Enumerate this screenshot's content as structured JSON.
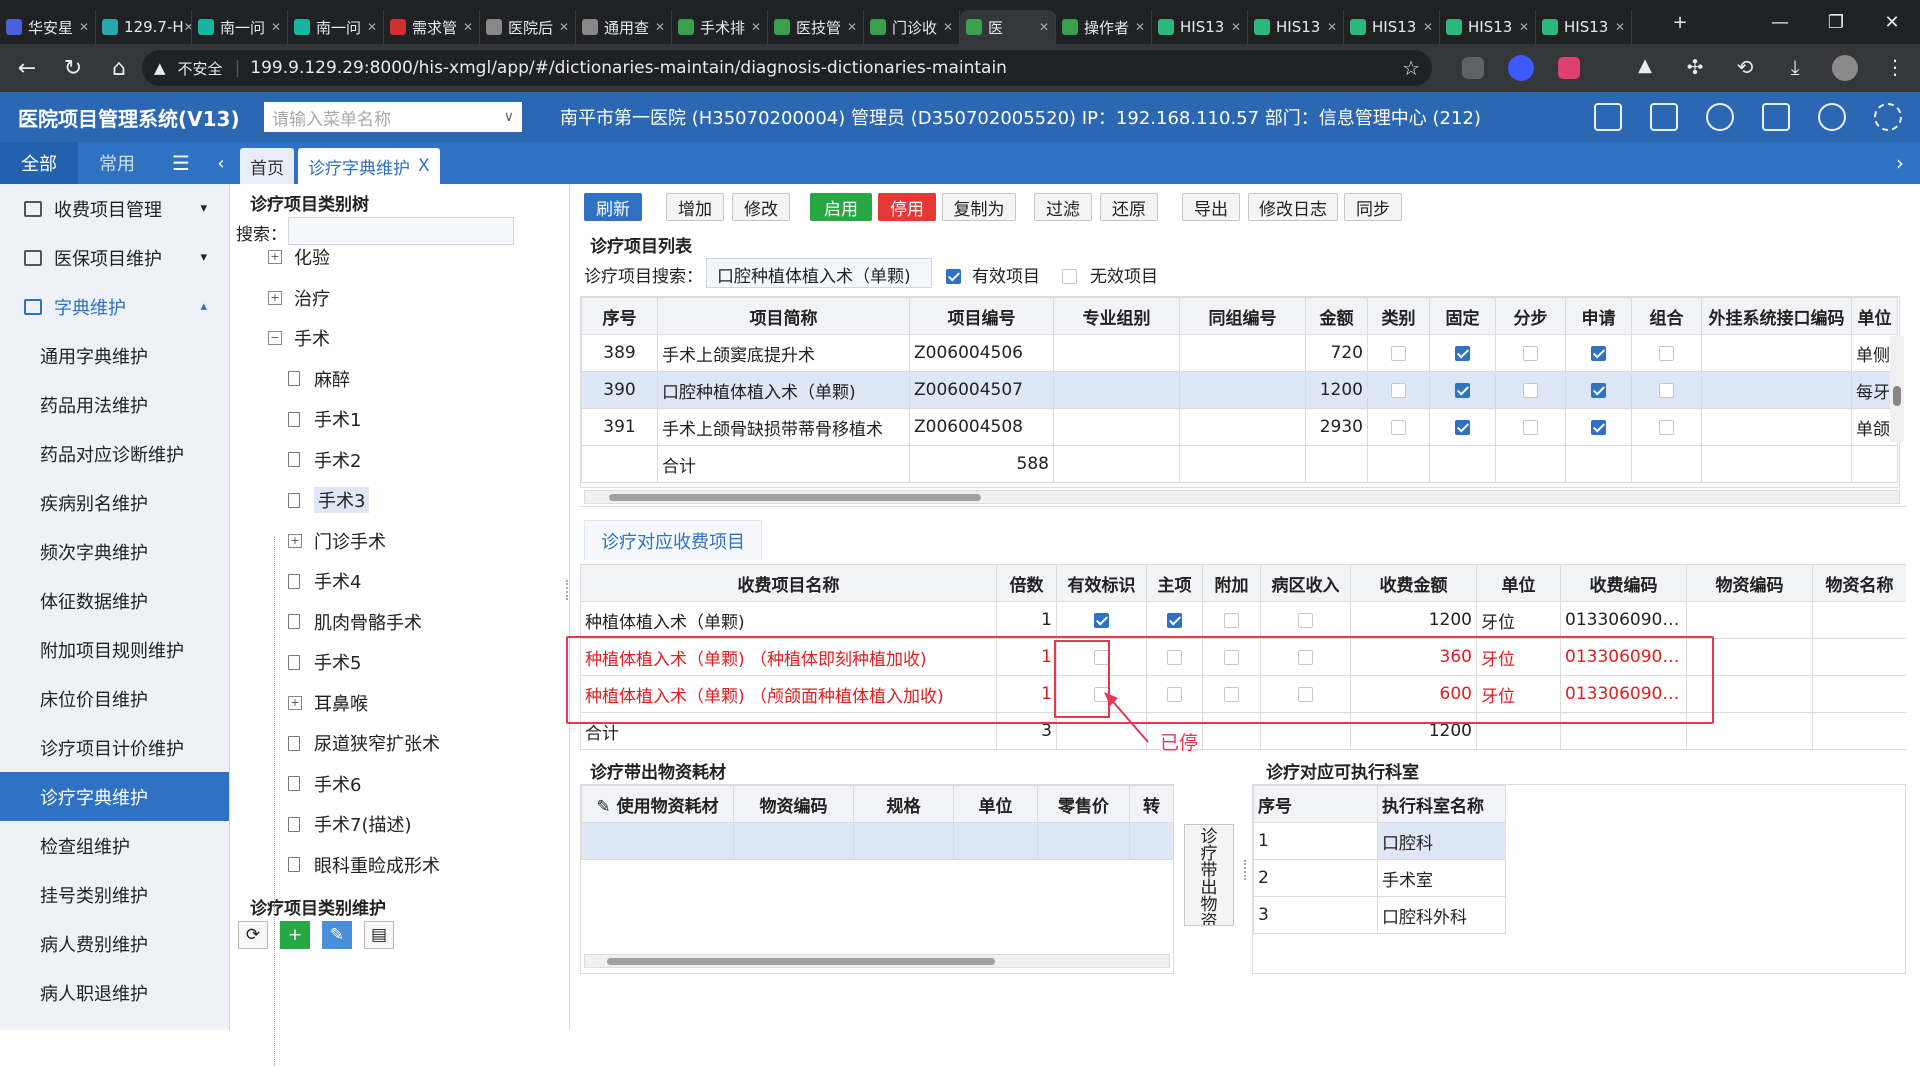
{
  "browser": {
    "tabs": [
      {
        "label": "华安星",
        "color": "#4a5fd8"
      },
      {
        "label": "129.7-H",
        "color": "#2aa8a8"
      },
      {
        "label": "南一问",
        "color": "#17b5a0"
      },
      {
        "label": "南一问",
        "color": "#17b5a0"
      },
      {
        "label": "需求管",
        "color": "#d03030"
      },
      {
        "label": "医院后",
        "color": "#888"
      },
      {
        "label": "通用查",
        "color": "#888"
      },
      {
        "label": "手术排",
        "color": "#3aa050"
      },
      {
        "label": "医技管",
        "color": "#3aa050"
      },
      {
        "label": "门诊收",
        "color": "#3aa050"
      },
      {
        "label": "医",
        "color": "#3aa050"
      },
      {
        "label": "操作者",
        "color": "#3aa050"
      },
      {
        "label": "HIS13",
        "color": "#2fb57a"
      },
      {
        "label": "HIS13",
        "color": "#2fb57a"
      },
      {
        "label": "HIS13",
        "color": "#2fb57a"
      },
      {
        "label": "HIS13",
        "color": "#2fb57a"
      },
      {
        "label": "HIS13",
        "color": "#2fb57a"
      }
    ],
    "active_tab": 10,
    "new_tab": "+",
    "security_label": "不安全",
    "url": "199.9.129.29:8000/his-xmgl/app/#/dictionaries-maintain/diagnosis-dictionaries-maintain"
  },
  "app": {
    "title": "医院项目管理系统(V13)",
    "menu_search_placeholder": "请输入菜单名称",
    "info": "南平市第一医院 (H35070200004) 管理员 (D350702005520) IP：192.168.110.57 部门：信息管理中心 (212)"
  },
  "subbar": {
    "tab_all": "全部",
    "tab_common": "常用",
    "page_home": "首页",
    "page_current": "诊疗字典维护",
    "close": "X"
  },
  "sidebar": {
    "groups": [
      {
        "label": "收费项目管理",
        "chev": "▾"
      },
      {
        "label": "医保项目维护",
        "chev": "▾"
      },
      {
        "label": "字典维护",
        "chev": "▴"
      }
    ],
    "items": [
      "通用字典维护",
      "药品用法维护",
      "药品对应诊断维护",
      "疾病别名维护",
      "频次字典维护",
      "体征数据维护",
      "附加项目规则维护",
      "床位价目维护",
      "诊疗项目计价维护",
      "诊疗字典维护",
      "检查组维护",
      "挂号类别维护",
      "病人费别维护",
      "病人职退维护"
    ]
  },
  "tree": {
    "title": "诊疗项目类别树",
    "search_label": "搜索：",
    "nodes": [
      "化验",
      "治疗",
      "手术",
      "麻醉",
      "手术1",
      "手术2",
      "手术3",
      "门诊手术",
      "手术4",
      "肌肉骨骼手术",
      "手术5",
      "耳鼻喉",
      "尿道狭窄扩张术",
      "手术6",
      "手术7(描述)",
      "眼科重睑成形术"
    ],
    "maint_title": "诊疗项目类别维护"
  },
  "toolbar": {
    "refresh": "刷新",
    "add": "增加",
    "edit": "修改",
    "enable": "启用",
    "disable": "停用",
    "copy": "复制为",
    "filter": "过滤",
    "restore": "还原",
    "export": "导出",
    "log": "修改日志",
    "sync": "同步"
  },
  "items_list": {
    "title": "诊疗项目列表",
    "search_label": "诊疗项目搜索：",
    "search_value": "口腔种植体植入术（单颗)",
    "valid_label": "有效项目",
    "invalid_label": "无效项目",
    "headers": [
      "序号",
      "项目简称",
      "项目编号",
      "专业组别",
      "同组编号",
      "金额",
      "类别",
      "固定",
      "分步",
      "申请",
      "组合",
      "外挂系统接口编码",
      "单位"
    ],
    "rows": [
      {
        "no": "389",
        "name": "手术上颌窦底提升术",
        "code": "Z006004506",
        "amount": "720",
        "unit": "单侧",
        "fixed": true,
        "apply": true
      },
      {
        "no": "390",
        "name": "口腔种植体植入术（单颗)",
        "code": "Z006004507",
        "amount": "1200",
        "unit": "每牙",
        "fixed": true,
        "apply": true
      },
      {
        "no": "391",
        "name": "手术上颌骨缺损带蒂骨移植术",
        "code": "Z006004508",
        "amount": "2930",
        "unit": "单颌",
        "fixed": true,
        "apply": true
      }
    ],
    "total_label": "合计",
    "total_value": "588"
  },
  "fee_panel": {
    "tab": "诊疗对应收费项目",
    "headers": [
      "收费项目名称",
      "倍数",
      "有效标识",
      "主项",
      "附加",
      "病区收入",
      "收费金额",
      "单位",
      "收费编码",
      "物资编码",
      "物资名称"
    ],
    "rows": [
      {
        "name": "种植体植入术（单颗)",
        "mult": "1",
        "valid": true,
        "main": true,
        "amount": "1200",
        "unit": "牙位",
        "code": "0133060900..."
      },
      {
        "name": "种植体植入术（单颗) （种植体即刻种植加收)",
        "mult": "1",
        "valid": false,
        "main": false,
        "amount": "360",
        "unit": "牙位",
        "code": "0133060900..."
      },
      {
        "name": "种植体植入术（单颗) （颅颌面种植体植入加收)",
        "mult": "1",
        "valid": false,
        "main": false,
        "amount": "600",
        "unit": "牙位",
        "code": "0133060900..."
      }
    ],
    "total_label": "合计",
    "total_mult": "3",
    "total_amount": "1200",
    "annotation": "已停"
  },
  "material_panel": {
    "title": "诊疗带出物资耗材",
    "headers": [
      "使用物资耗材",
      "物资编码",
      "规格",
      "单位",
      "零售价",
      "转"
    ],
    "save_btn": "诊疗带出物资耗材保存"
  },
  "dept_panel": {
    "title": "诊疗对应可执行科室",
    "headers": [
      "序号",
      "执行科室名称"
    ],
    "rows": [
      {
        "no": "1",
        "name": "口腔科"
      },
      {
        "no": "2",
        "name": "手术室"
      },
      {
        "no": "3",
        "name": "口腔科外科"
      }
    ]
  }
}
